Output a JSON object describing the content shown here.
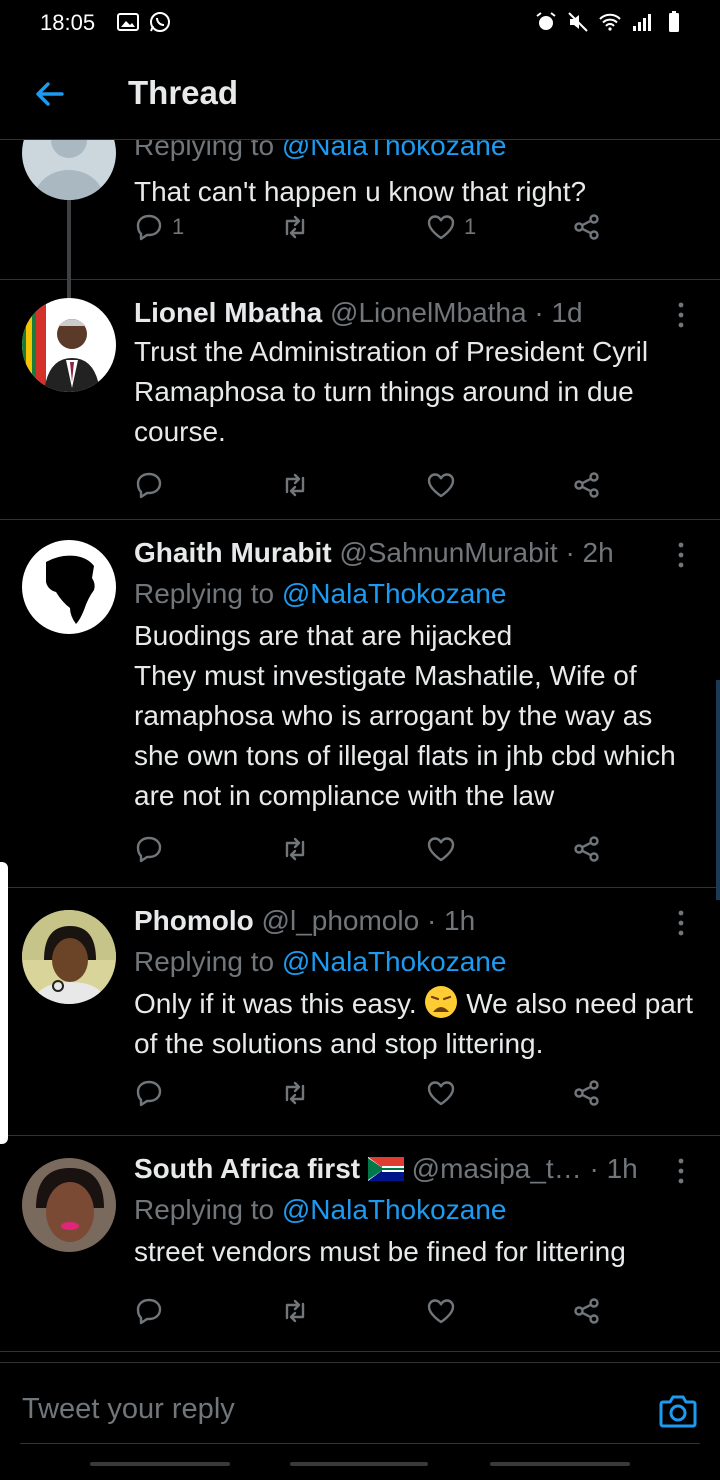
{
  "status": {
    "time": "18:05"
  },
  "header": {
    "title": "Thread"
  },
  "tweets": [
    {
      "reply_prefix": "Replying to ",
      "reply_mention": "@NalaThokozane",
      "text": "That can't happen u know that right?",
      "reply_count": "1",
      "like_count": "1"
    },
    {
      "name": "Lionel Mbatha",
      "handle": "@LionelMbatha",
      "time": "· 1d",
      "text": "Trust the Administration of President Cyril Ramaphosa to turn things around in due course."
    },
    {
      "name": "Ghaith Murabit",
      "handle": "@SahnunMurabit",
      "time": "· 2h",
      "reply_prefix": "Replying to ",
      "reply_mention": "@NalaThokozane",
      "text": "Buodings are that are hijacked\nThey must investigate Mashatile, Wife of ramaphosa who is arrogant by the way as she own tons of illegal flats in jhb cbd which are not in compliance with the law"
    },
    {
      "name": "Phomolo",
      "handle": "@l_phomolo",
      "time": "· 1h",
      "reply_prefix": "Replying to ",
      "reply_mention": "@NalaThokozane",
      "text_before_emoji": "Only if it was this easy.",
      "text_after_emoji": " We also need part of the solutions and stop littering."
    },
    {
      "name": "South Africa first",
      "handle": "@masipa_t…",
      "time": "· 1h",
      "reply_prefix": "Replying to ",
      "reply_mention": "@NalaThokozane",
      "text": "street vendors must be fined for littering"
    }
  ],
  "reply_bar": {
    "placeholder": "Tweet your reply"
  },
  "colors": {
    "background": "#000000",
    "accent": "#1d9bf0",
    "muted": "#71767b",
    "text": "#e7e9ea",
    "divider": "#2f3336"
  }
}
